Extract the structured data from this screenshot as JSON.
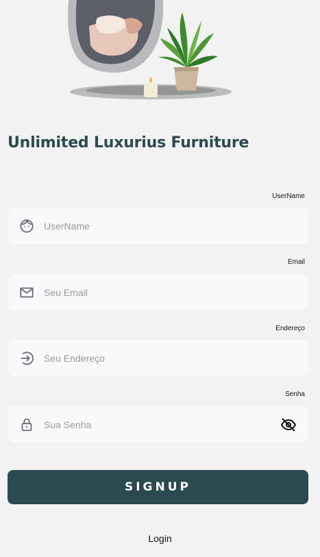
{
  "app": {
    "title": "Unlimited Luxurius Furniture"
  },
  "form": {
    "username": {
      "label": "UserName",
      "placeholder": "UserName",
      "value": ""
    },
    "email": {
      "label": "Email",
      "placeholder": "Seu Email",
      "value": ""
    },
    "address": {
      "label": "Endereço",
      "placeholder": "Seu Endereço",
      "value": ""
    },
    "password": {
      "label": "Senha",
      "placeholder": "Sua Senha",
      "value": ""
    }
  },
  "actions": {
    "signup_label": "SIGNUP",
    "login_label": "Login"
  },
  "icons": {
    "username": "face-icon",
    "email": "mail-icon",
    "address": "login-arrow-icon",
    "password": "lock-icon",
    "visibility": "eye-off-icon"
  },
  "colors": {
    "brand": "#2b4a4f",
    "background": "#f2f2f2",
    "field": "#f9f9fb",
    "icon": "#6e6a78"
  }
}
